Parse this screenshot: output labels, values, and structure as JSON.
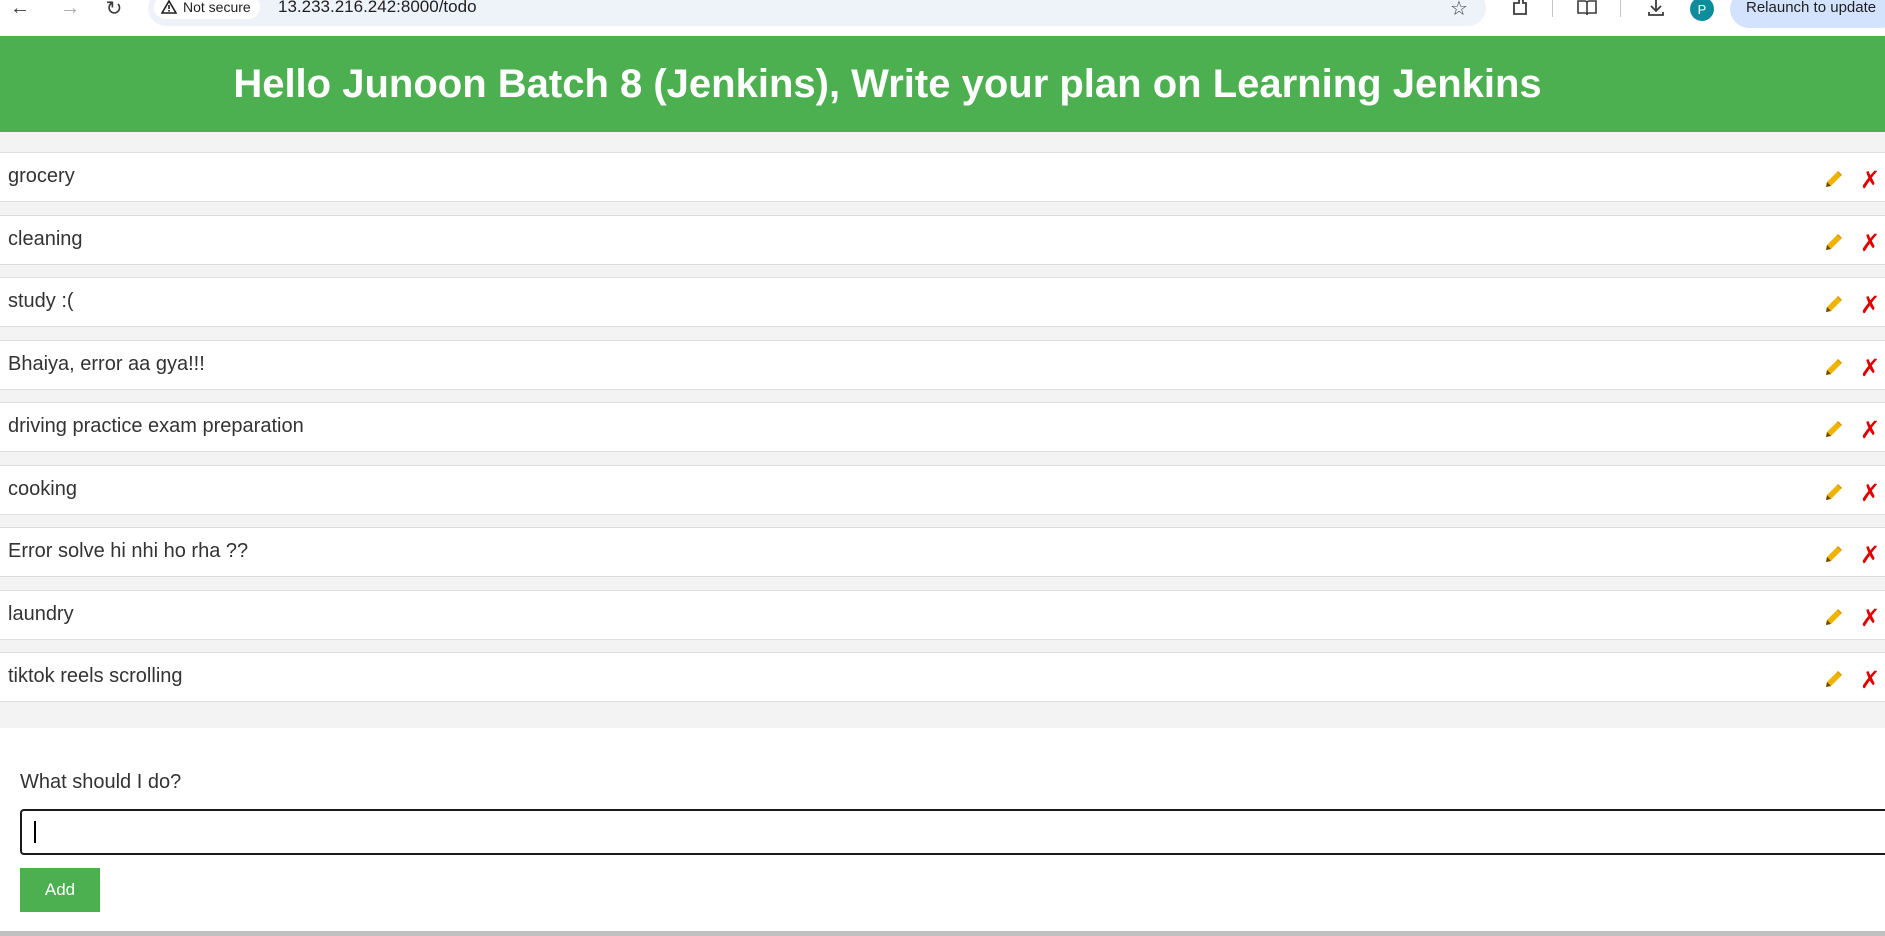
{
  "browser": {
    "security_label": "Not secure",
    "url": "13.233.216.242:8000/todo",
    "profile_initial": "P",
    "relaunch_label": "Relaunch to update"
  },
  "header": {
    "title": "Hello Junoon Batch 8 (Jenkins), Write your plan on Learning Jenkins"
  },
  "todos": [
    {
      "text": "grocery"
    },
    {
      "text": "cleaning"
    },
    {
      "text": "study :("
    },
    {
      "text": "Bhaiya, error aa gya!!!"
    },
    {
      "text": "driving practice exam preparation"
    },
    {
      "text": "cooking"
    },
    {
      "text": "Error solve hi nhi ho rha ??"
    },
    {
      "text": "laundry"
    },
    {
      "text": "tiktok reels scrolling"
    }
  ],
  "form": {
    "label": "What should I do?",
    "input_value": "",
    "add_label": "Add"
  },
  "colors": {
    "header_bg": "#4caf50",
    "edit_icon": "#f0b400",
    "delete_icon": "#e00000"
  },
  "icons": {
    "edit": "pencil-icon",
    "delete": "cross-icon"
  }
}
